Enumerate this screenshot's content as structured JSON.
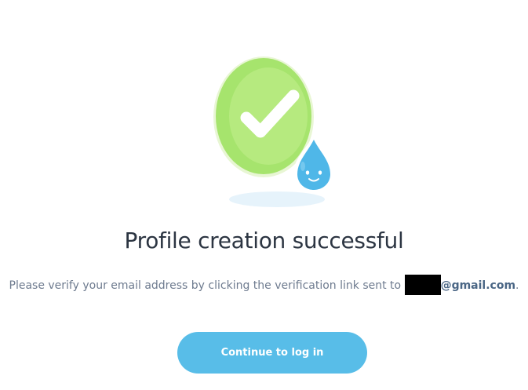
{
  "success": {
    "title": "Profile creation successful",
    "message_prefix": "Please verify your email address by clicking the verification link sent to",
    "email_domain": "@gmail.com",
    "message_suffix": ".",
    "continue_label": "Continue to log in"
  },
  "illustration": {
    "check_icon": "checkmark-icon",
    "mascot_icon": "water-drop-mascot-icon"
  },
  "colors": {
    "check_circle_outer": "#a6e46d",
    "check_circle_inner": "#b6ea7f",
    "drop": "#4fb7e8",
    "button": "#58bde8",
    "title": "#2c3542",
    "body_text": "#6e7b8f",
    "email_text": "#4a6685"
  }
}
